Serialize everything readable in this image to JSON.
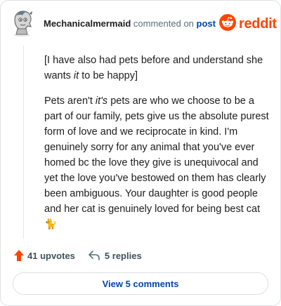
{
  "header": {
    "username": "Mechanicalmermaid",
    "commented_on": "commented on",
    "post_link": "post",
    "brand": "reddit"
  },
  "comment": {
    "para1_text": "[I have also had pets before and understand she wants ",
    "para1_em": "it",
    "para1_end": " to be happy]",
    "para2_a": "Pets aren't ",
    "para2_em": "it's",
    "para2_b": " pets are who we choose to be a part of our family, pets give us the absolute purest form of love and we reciprocate in kind. I'm genuinely sorry for any animal that you've ever homed bc the love they give is unequivocal and yet the love you've bestowed on them has clearly been ambiguous. Your daughter is good people and her cat is genuinely loved for being best cat",
    "emoji": "🐈"
  },
  "actions": {
    "upvotes": "41 upvotes",
    "replies": "5 replies"
  },
  "view_comments_label": "View 5 comments",
  "colors": {
    "reddit_orange": "#ff4500",
    "link_blue": "#0045ac"
  },
  "icons": [
    "avatar",
    "reddit-logo-icon",
    "upvote-arrow-icon",
    "reply-arrow-icon"
  ]
}
